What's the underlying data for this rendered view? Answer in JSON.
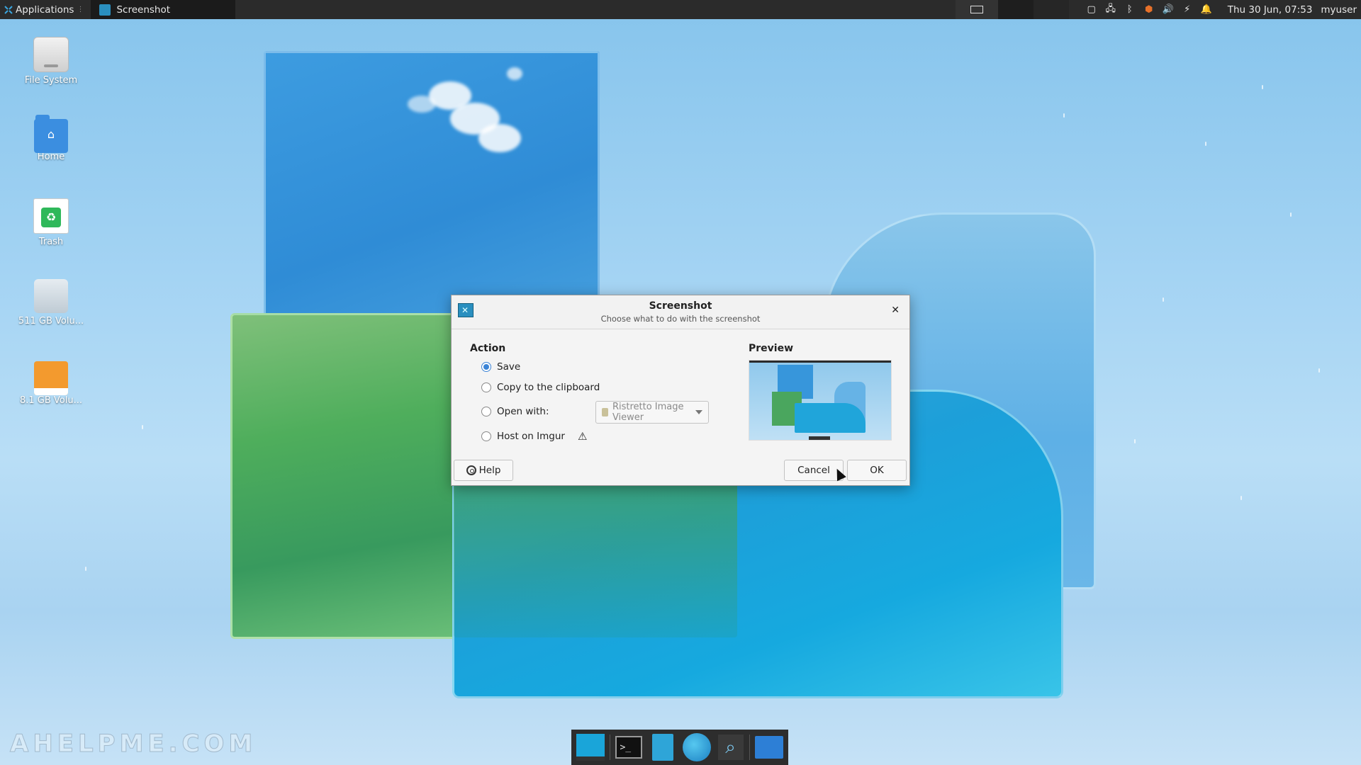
{
  "panel": {
    "applications_label": "Applications",
    "task_title": "Screenshot",
    "clock": "Thu 30 Jun, 07:53",
    "user": "myuser",
    "tray_icons": [
      "clipboard-icon",
      "network-icon",
      "bluetooth-icon",
      "shield-icon",
      "volume-icon",
      "power-icon",
      "bell-icon"
    ]
  },
  "desktop": {
    "icons": [
      {
        "label": "File System",
        "icon": "drive-icon"
      },
      {
        "label": "Home",
        "icon": "home-folder-icon"
      },
      {
        "label": "Trash",
        "icon": "trash-icon"
      },
      {
        "label": "511 GB Volu...",
        "icon": "drive-icon"
      },
      {
        "label": "8.1 GB Volu...",
        "icon": "usb-drive-icon"
      }
    ],
    "watermark": "AHELPME.COM"
  },
  "dialog": {
    "title": "Screenshot",
    "subtitle": "Choose what to do with the screenshot",
    "action_label": "Action",
    "preview_label": "Preview",
    "options": {
      "save": "Save",
      "clipboard": "Copy to the clipboard",
      "open_with": "Open with:",
      "imgur": "Host on Imgur"
    },
    "selected_option": "save",
    "open_with_app": "Ristretto Image Viewer",
    "buttons": {
      "help": "Help",
      "cancel": "Cancel",
      "ok": "OK"
    }
  },
  "dock": {
    "items": [
      "desktop-icon",
      "terminal-icon",
      "file-manager-icon",
      "web-browser-icon",
      "app-finder-icon",
      "folder-icon"
    ]
  }
}
